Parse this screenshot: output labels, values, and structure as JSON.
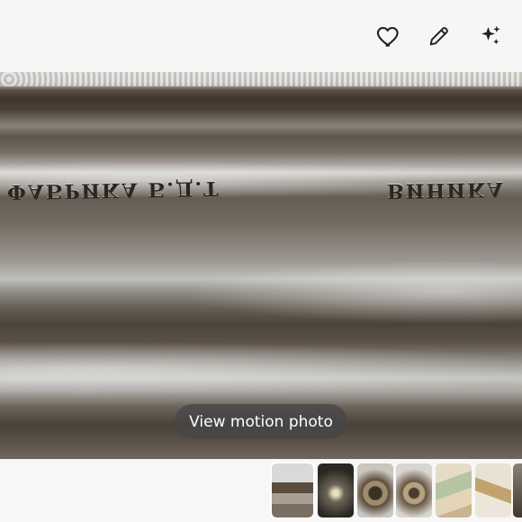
{
  "toolbar": {
    "favorite_icon": "heart-outline-icon",
    "edit_icon": "pencil-icon",
    "effects_icon": "sparkle-icon"
  },
  "photo": {
    "engraved_text_left": "ФАБРИКА Б.Д.Т",
    "engraved_text_right": "ВИНИКА",
    "motion_button_label": "View motion photo"
  },
  "filmstrip": {
    "count": 7,
    "selected_index": 0
  }
}
